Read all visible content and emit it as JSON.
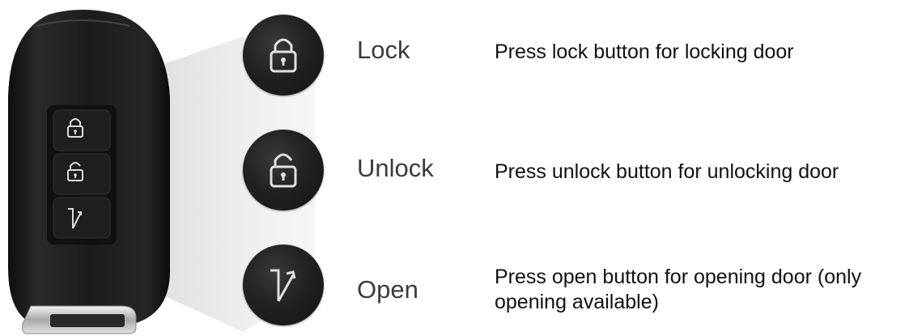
{
  "items": [
    {
      "id": "lock",
      "icon": "lock-icon",
      "label": "Lock",
      "description": "Press lock button for locking door"
    },
    {
      "id": "unlock",
      "icon": "unlock-icon",
      "label": "Unlock",
      "description": "Press unlock button for unlocking door"
    },
    {
      "id": "open",
      "icon": "door-open-icon",
      "label": "Open",
      "description": "Press open button for opening door (only opening available)"
    }
  ],
  "colors": {
    "fob_body": "#1a1a1a",
    "icon_stroke": "#e0e0e0",
    "label_text": "#3b3b3b",
    "description_text": "#111111",
    "callout_gray": "#d9d9d9"
  }
}
